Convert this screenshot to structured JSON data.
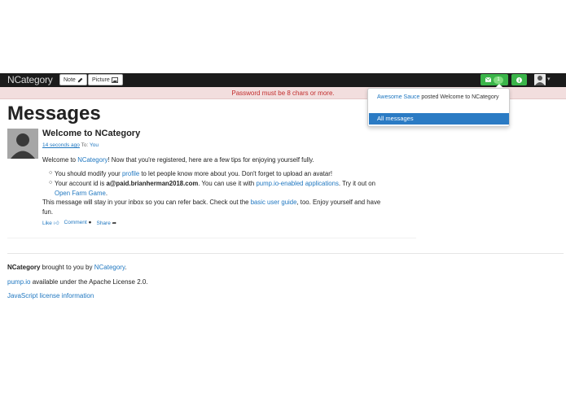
{
  "navbar": {
    "brand": "NCategory",
    "note_label": "Note",
    "picture_label": "Picture",
    "message_count": "1"
  },
  "alert": {
    "text": "Password must be 8 chars or more."
  },
  "dropdown": {
    "item_actor": "Awesome Sauce",
    "item_text": " posted Welcome to NCategory",
    "all_messages": "All messages"
  },
  "main": {
    "title": "Messages",
    "activity": {
      "title": "Welcome to NCategory",
      "time": "14 seconds ago",
      "to_label": "To:",
      "to_value": "You",
      "intro_prefix": "Welcome to ",
      "intro_link": "NCategory",
      "intro_suffix": "! Now that you're registered, here are a few tips for enjoying yourself fully.",
      "bullet1_prefix": "You should modify your ",
      "bullet1_link": "profile",
      "bullet1_suffix": " to let people know more about you. Don't forget to upload an avatar!",
      "bullet2_prefix": "Your account id is ",
      "bullet2_account": "a@paid.brianherman2018.com",
      "bullet2_mid": ". You can use it with ",
      "bullet2_link": "pump.io-enabled applications",
      "bullet2_suffix": ". Try it out on",
      "bullet2_link2": "Open Farm Game",
      "bullet2_end": ".",
      "outro_prefix": "This message will stay in your inbox so you can refer back. Check out the ",
      "outro_link": "basic user guide",
      "outro_suffix": ", too. Enjoy yourself and have",
      "outro_line2": "fun.",
      "like": "Like",
      "comment": "Comment",
      "share": "Share"
    }
  },
  "footer": {
    "line1_bold": "NCategory",
    "line1_text": " brought to you by ",
    "line1_link": "NCategory",
    "line1_end": ".",
    "line2_link": "pump.io",
    "line2_text": " available under the Apache License 2.0.",
    "line3_link": "JavaScript license information"
  },
  "colors": {
    "accent": "#1f77c0",
    "green": "#3bb54a",
    "alert_text": "#c22d2d",
    "alert_bg": "#f2dede",
    "dropdown_selected": "#2b7bc4"
  }
}
